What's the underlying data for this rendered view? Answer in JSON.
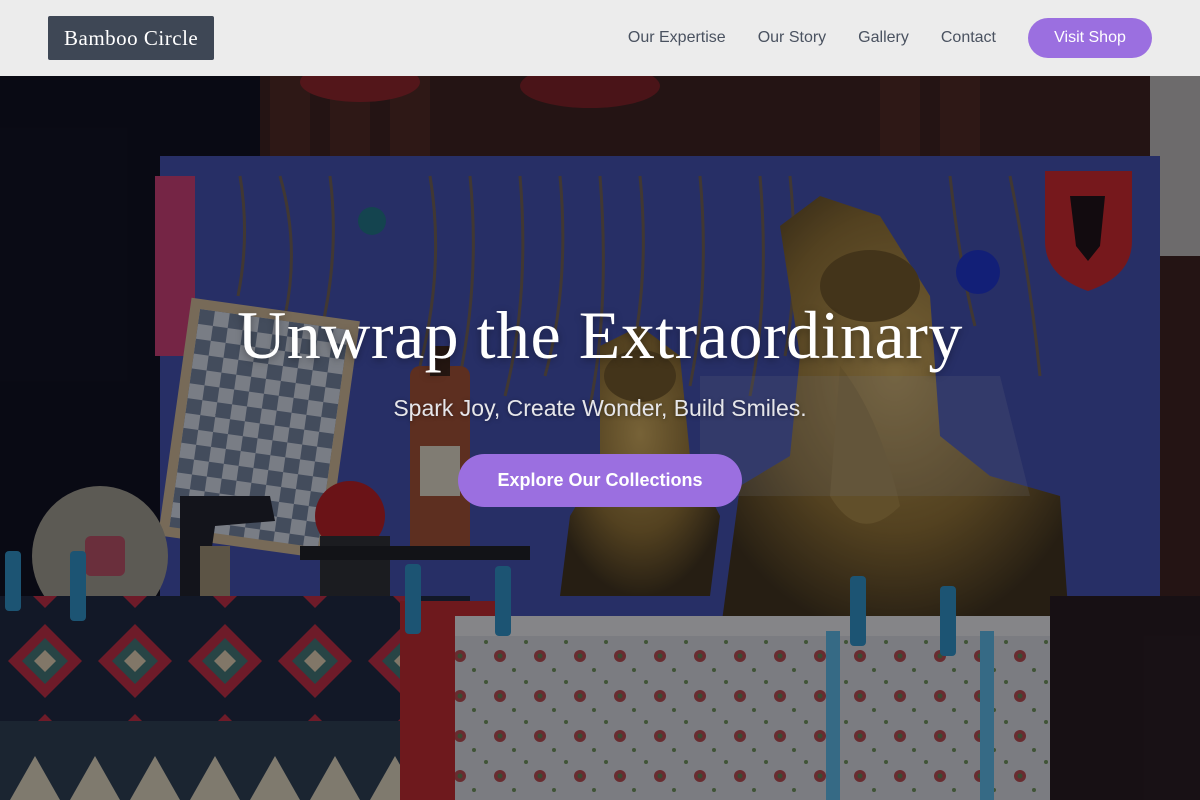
{
  "header": {
    "logo": "Bamboo Circle",
    "nav": [
      "Our Expertise",
      "Our Story",
      "Gallery",
      "Contact"
    ],
    "shop_label": "Visit Shop"
  },
  "hero": {
    "title": "Unwrap the Extraordinary",
    "subtitle": "Spark Joy, Create Wonder, Build Smiles.",
    "cta_label": "Explore Our Collections",
    "image_desc": "background-photo-souvenir-market-stall"
  },
  "colors": {
    "accent": "#9b6fe0",
    "logo_bg": "#3e4755",
    "header_bg": "#ececec",
    "nav_text": "#4a5260"
  }
}
